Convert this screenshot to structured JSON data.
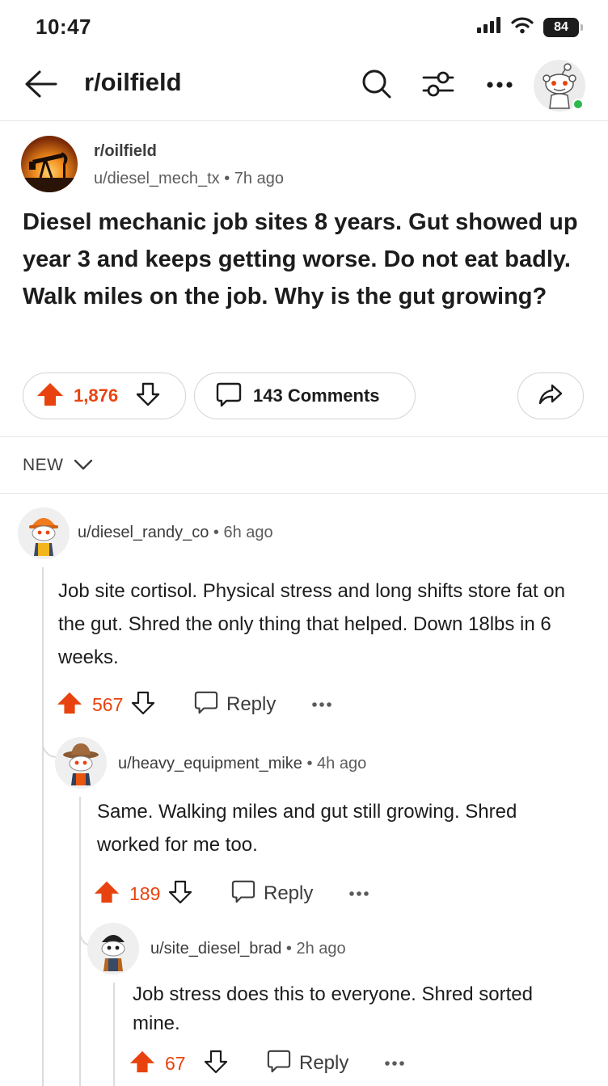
{
  "status": {
    "time": "10:47",
    "battery": "84"
  },
  "header": {
    "subreddit": "r/oilfield"
  },
  "post": {
    "subreddit": "r/oilfield",
    "author": "u/diesel_mech_tx",
    "time": "7h ago",
    "title": "Diesel mechanic job sites 8 years. Gut showed up year 3 and keeps getting worse. Do not eat badly. Walk miles on the job. Why is the gut growing?",
    "votes": "1,876",
    "comments_label": "143 Comments"
  },
  "sort": {
    "label": "NEW"
  },
  "comments": [
    {
      "author": "u/diesel_randy_co",
      "time": "6h ago",
      "body": "Job site cortisol. Physical stress and long shifts store fat on the gut. Shred the only thing that helped. Down 18lbs in 6 weeks.",
      "score": "567",
      "reply_label": "Reply"
    },
    {
      "author": "u/heavy_equipment_mike",
      "time": "4h ago",
      "body": "Same. Walking miles and gut still growing. Shred worked for me too.",
      "score": "189",
      "reply_label": "Reply"
    },
    {
      "author": "u/site_diesel_brad",
      "time": "2h ago",
      "body": "Job stress does this to everyone. Shred sorted mine.",
      "score": "67",
      "reply_label": "Reply"
    }
  ],
  "colors": {
    "upvote": "#e8430f",
    "online": "#2db84d"
  },
  "icons": [
    "back-arrow-icon",
    "search-icon",
    "filter-icon",
    "more-icon",
    "upvote-icon",
    "downvote-icon",
    "comment-icon",
    "share-icon",
    "chevron-down-icon",
    "reply-icon"
  ]
}
